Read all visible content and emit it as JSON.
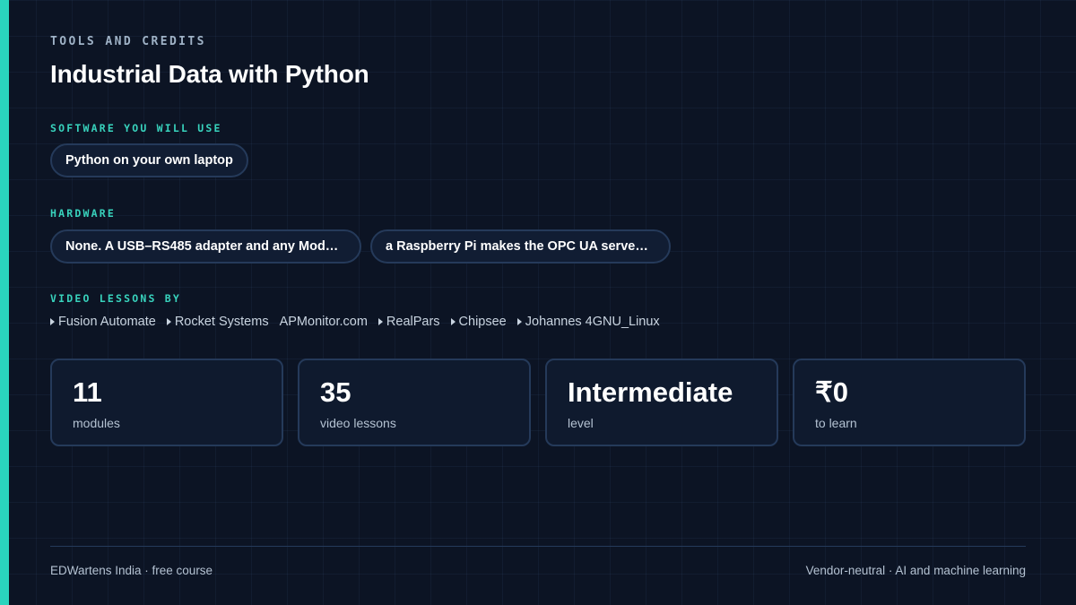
{
  "header": {
    "eyebrow": "TOOLS AND CREDITS",
    "title": "Industrial Data with Python"
  },
  "software": {
    "label": "SOFTWARE YOU WILL USE",
    "chips": [
      "Python on your own laptop"
    ]
  },
  "hardware": {
    "label": "HARDWARE",
    "chips": [
      "None. A USB–RS485 adapter and any Mod…",
      "a Raspberry Pi makes the OPC UA serve…"
    ]
  },
  "credits": {
    "label": "VIDEO LESSONS BY",
    "items": [
      {
        "icon": "caret-right-icon",
        "name": "Fusion Automate"
      },
      {
        "icon": "caret-right-icon",
        "name": "Rocket Systems"
      },
      {
        "icon": "",
        "name": "APMonitor.com"
      },
      {
        "icon": "caret-right-icon",
        "name": "RealPars"
      },
      {
        "icon": "caret-right-icon",
        "name": "Chipsee"
      },
      {
        "icon": "caret-right-icon",
        "name": "Johannes 4GNU_Linux"
      }
    ]
  },
  "stats": [
    {
      "value": "11",
      "label": "modules"
    },
    {
      "value": "35",
      "label": "video lessons"
    },
    {
      "value": "Intermediate",
      "label": "level"
    },
    {
      "value": "₹0",
      "label": "to learn"
    }
  ],
  "footer": {
    "left": "EDWartens India · free course",
    "right": "Vendor-neutral · AI and machine learning"
  },
  "colors": {
    "background": "#0c1424",
    "accent": "#2ad4bd",
    "border": "#253a5a"
  }
}
